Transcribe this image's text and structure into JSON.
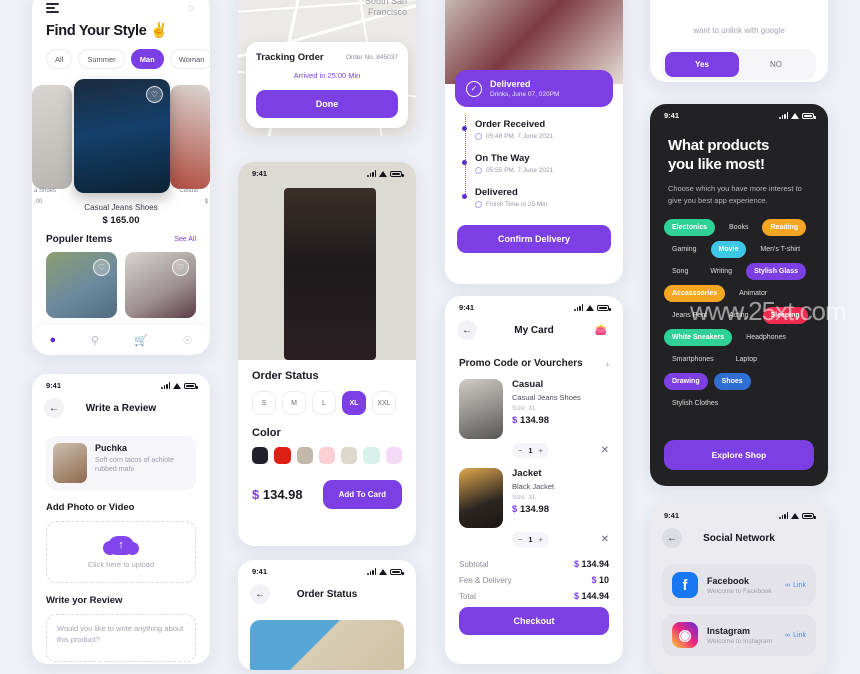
{
  "status_bar": {
    "time": "9:41"
  },
  "home": {
    "title": "Find Your Style ✌️",
    "menu_icon": "menu-icon",
    "bell_icon": "bell-icon",
    "filters": [
      {
        "label": "All",
        "selected": false
      },
      {
        "label": "Summer",
        "selected": false
      },
      {
        "label": "Man",
        "selected": true
      },
      {
        "label": "Woman",
        "selected": false
      }
    ],
    "featured": {
      "name": "Casual Jeans Shoes",
      "price": "$ 165.00"
    },
    "side_left_label": "a Shoes",
    "side_left_price": ".00",
    "side_right_label": "Casual",
    "side_right_price": "$",
    "section_title": "Populer Items",
    "see_all": "See All",
    "tabs": [
      "home-icon",
      "search-icon",
      "cart-icon",
      "profile-icon"
    ]
  },
  "review": {
    "nav_title": "Write a Review",
    "product": {
      "name": "Puchka",
      "desc": "Soft corn tacos of achiote rubbed mahi"
    },
    "photo_section": "Add Photo or Video",
    "upload_hint": "Click here to upload",
    "write_section": "Write yor Review",
    "textarea_placeholder": "Would you like to write anything about this product?"
  },
  "tracking": {
    "map_city": "South San\nFrancisco",
    "title": "Tracking Order",
    "order_no": "Order No. 845037",
    "eta": "Arrived in 25:00 Min",
    "done_label": "Done"
  },
  "detail": {
    "section_title": "Order Status",
    "sizes": [
      {
        "label": "S",
        "selected": false
      },
      {
        "label": "M",
        "selected": false
      },
      {
        "label": "L",
        "selected": false
      },
      {
        "label": "XL",
        "selected": true
      },
      {
        "label": "XXL",
        "selected": false
      }
    ],
    "color_title": "Color",
    "colors": [
      "#22202b",
      "#e01f13",
      "#c3b8ac",
      "#fbd0d4",
      "#ddd8cc",
      "#d6f2ea",
      "#f3dbf5"
    ],
    "price_symbol": "$",
    "price": "134.98",
    "add_label": "Add To Card"
  },
  "order_status": {
    "nav_title": "Order Status"
  },
  "delivery": {
    "banner": {
      "title": "Delivered",
      "subtitle": "Drinks, June 07, 020PM",
      "icon": "check-circle-icon"
    },
    "timeline": [
      {
        "title": "Order Received",
        "time": "05:48 PM, 7 June 2021"
      },
      {
        "title": "On The Way",
        "time": "05:55 PM, 7 June 2021"
      },
      {
        "title": "Delivered",
        "time": "Finish Time in 25 Min."
      }
    ],
    "confirm_label": "Confirm Delivery"
  },
  "cart": {
    "nav_title": "My Card",
    "bag_icon": "bag-icon",
    "promo_label": "Promo Code or Vourchers",
    "promo_chevron": "›",
    "items": [
      {
        "title": "Casual",
        "subtitle": "Casual Jeans Shoes",
        "size": "Size: XL",
        "price_symbol": "$",
        "price": "134.98",
        "qty": "1"
      },
      {
        "title": "Jacket",
        "subtitle": "Black Jacket",
        "size": "Size: XL",
        "price_symbol": "$",
        "price": "134.98",
        "qty": "1"
      }
    ],
    "totals": [
      {
        "label": "Subtotal",
        "symbol": "$",
        "value": "134.94"
      },
      {
        "label": "Fee & Delivery",
        "symbol": "$",
        "value": "10"
      },
      {
        "label": "Total",
        "symbol": "$",
        "value": "144.94"
      }
    ],
    "checkout_label": "Checkout"
  },
  "unlink": {
    "message": "want to unlink with google",
    "yes_label": "Yes",
    "no_label": "NO"
  },
  "interests": {
    "title": "What products\nyou like most!",
    "subtitle": "Choose which you have more interest to give you best app experience.",
    "tags": [
      {
        "label": "Electonics",
        "color": "#2fd197",
        "selected": true
      },
      {
        "label": "Books",
        "color": "",
        "selected": false
      },
      {
        "label": "Reading",
        "color": "#f5a623",
        "selected": true
      },
      {
        "label": "Gaming",
        "color": "",
        "selected": false
      },
      {
        "label": "Movie",
        "color": "#3ec8e8",
        "selected": true
      },
      {
        "label": "Men's T-shirt",
        "color": "",
        "selected": false
      },
      {
        "label": "Song",
        "color": "",
        "selected": false
      },
      {
        "label": "Writing",
        "color": "",
        "selected": false
      },
      {
        "label": "Stylish Glass",
        "color": "#7b3fe4",
        "selected": true
      },
      {
        "label": "Accasssories",
        "color": "#f5a623",
        "selected": true
      },
      {
        "label": "Animator",
        "color": "",
        "selected": false
      },
      {
        "label": "Jeans Pent",
        "color": "",
        "selected": false
      },
      {
        "label": "Acting",
        "color": "",
        "selected": false
      },
      {
        "label": "Sleeping",
        "color": "#ee2b4e",
        "selected": true
      },
      {
        "label": "White Sneakers",
        "color": "#2fd197",
        "selected": true
      },
      {
        "label": "Headphones",
        "color": "",
        "selected": false
      },
      {
        "label": "Smartphones",
        "color": "",
        "selected": false
      },
      {
        "label": "Laptop",
        "color": "",
        "selected": false
      },
      {
        "label": "Drawing",
        "color": "#7b3fe4",
        "selected": true
      },
      {
        "label": "Shoes",
        "color": "#2f6fd1",
        "selected": true
      },
      {
        "label": "Stylish Clothes",
        "color": "",
        "selected": false
      }
    ],
    "explore_label": "Explore Shop"
  },
  "social": {
    "nav_title": "Social Network",
    "accounts": [
      {
        "name": "Facebook",
        "desc": "Welcome to Facebook",
        "link_label": "Link",
        "glyph": "f",
        "color": "#1877f2"
      },
      {
        "name": "Instagram",
        "desc": "Welcome to Instagram",
        "link_label": "Link",
        "glyph": "◎",
        "color": "#d6249f"
      }
    ]
  },
  "watermark": "www.25xt.com",
  "theme": {
    "accent": "#7b3fe4",
    "dark_bg": "#222224",
    "page_bg": "#eef0f6"
  }
}
